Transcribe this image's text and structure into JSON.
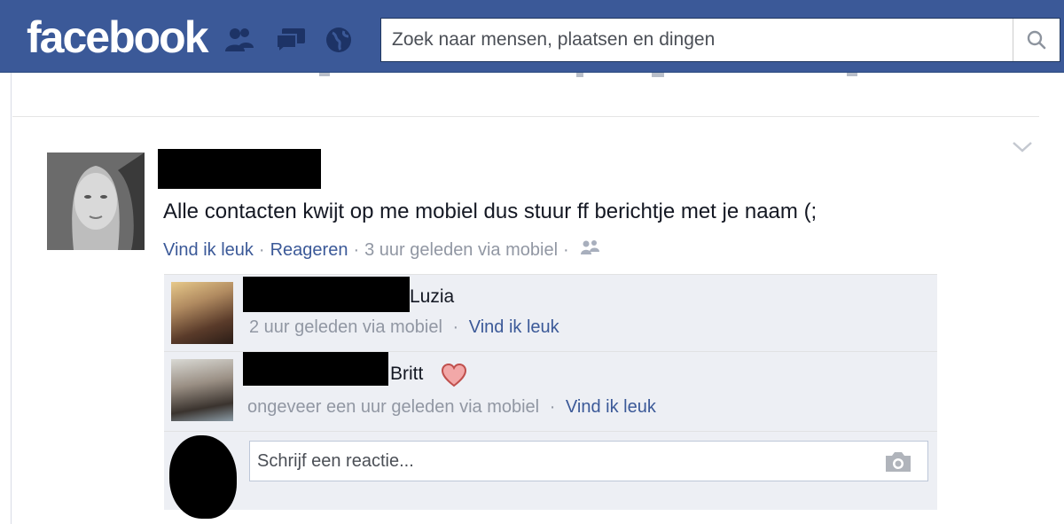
{
  "header": {
    "logo": "facebook",
    "icons": [
      "friend-requests-icon",
      "messages-icon",
      "notifications-globe-icon"
    ],
    "search": {
      "placeholder": "Zoek naar mensen, plaatsen en dingen",
      "value": ""
    },
    "search_icon": "magnifier-icon"
  },
  "colors": {
    "brand": "#3b5998",
    "link": "#3b5998",
    "meta": "#9197a3",
    "comment_bg": "#edeff4",
    "heart": "#e89a9a"
  },
  "post": {
    "text": "Alle contacten kwijt op me mobiel dus stuur ff berichtje met je naam (;",
    "like_label": "Vind ik leuk",
    "comment_label": "Reageren",
    "timestamp": "3 uur geleden via mobiel",
    "audience_icon": "friends-icon",
    "menu_icon": "chevron-down-icon"
  },
  "comments": [
    {
      "name": "Luzia",
      "meta": "2 uur geleden via mobiel",
      "like_label": "Vind ik leuk"
    },
    {
      "name": "Britt",
      "meta": "ongeveer een uur geleden via mobiel",
      "like_label": "Vind ik leuk",
      "emoji": "heart-icon"
    }
  ],
  "reply": {
    "placeholder": "Schrijf een reactie...",
    "attach_icon": "camera-icon"
  },
  "separator": "·"
}
